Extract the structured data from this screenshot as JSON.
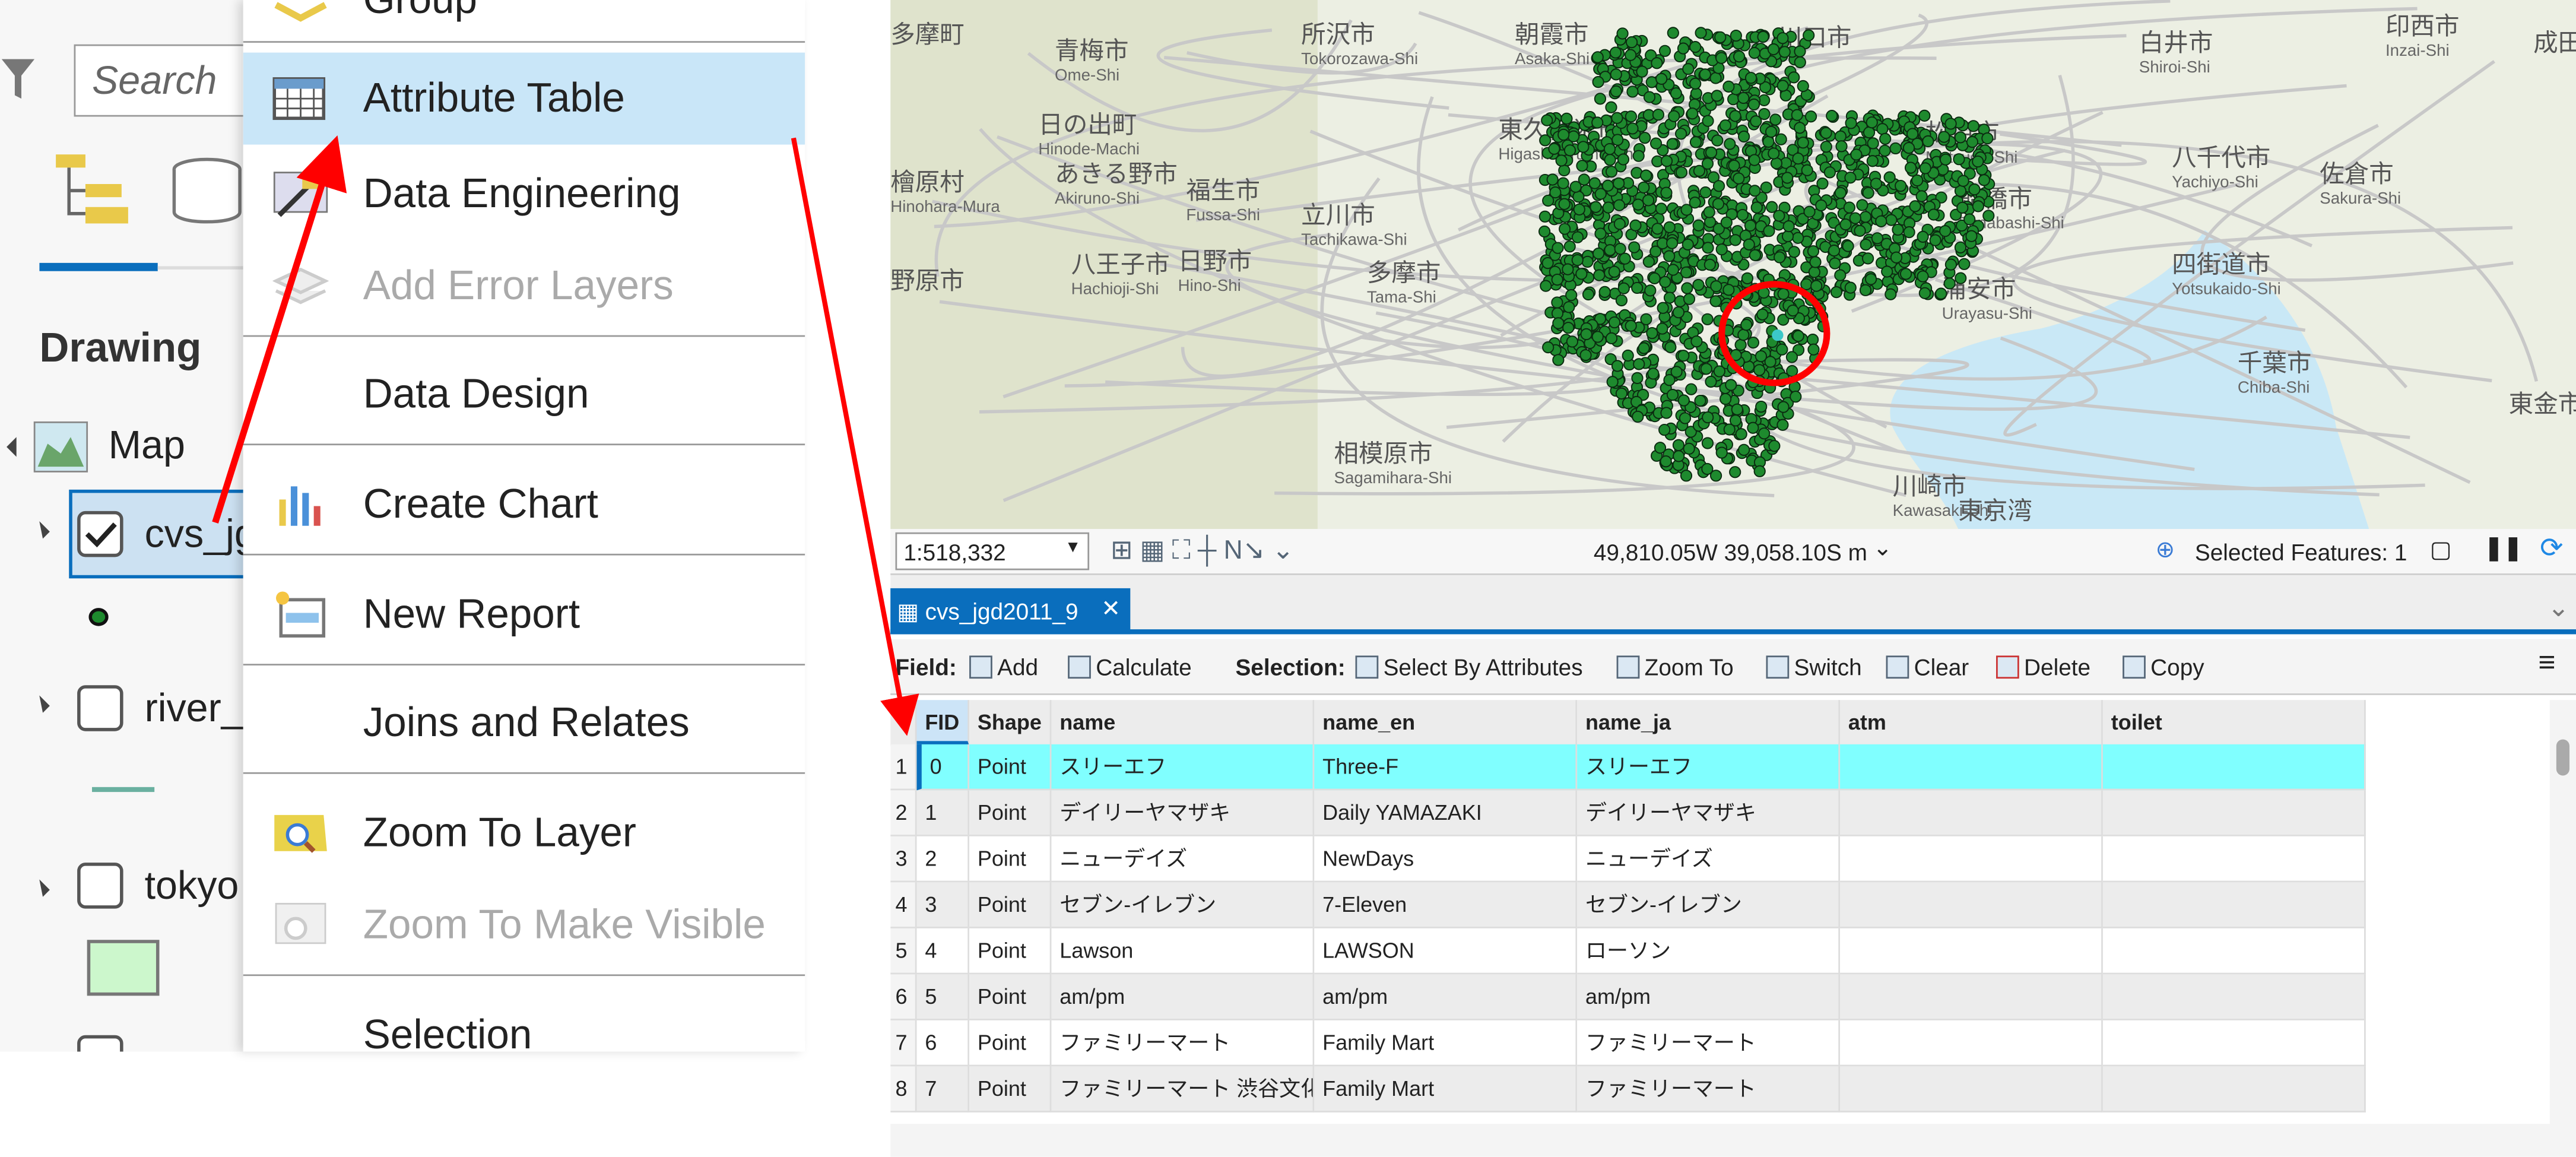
{
  "toc": {
    "search_placeholder": "Search",
    "heading": "Drawing",
    "layers": [
      {
        "label": "Map",
        "checked": null
      },
      {
        "label": "cvs_jg",
        "checked": true
      },
      {
        "label": "river_",
        "checked": false
      },
      {
        "label": "tokyo",
        "checked": false
      }
    ]
  },
  "menu": {
    "items": [
      {
        "label": "Group",
        "icon": "group-icon",
        "disabled": false
      },
      {
        "label": "Attribute Table",
        "icon": "table-icon",
        "disabled": false,
        "highlighted": true
      },
      {
        "label": "Data Engineering",
        "icon": "data-engineering-icon",
        "disabled": false
      },
      {
        "label": "Add Error Layers",
        "icon": "error-layers-icon",
        "disabled": true
      },
      {
        "label": "Data Design",
        "icon": "",
        "disabled": false
      },
      {
        "label": "Create Chart",
        "icon": "chart-icon",
        "disabled": false
      },
      {
        "label": "New Report",
        "icon": "report-icon",
        "disabled": false
      },
      {
        "label": "Joins and Relates",
        "icon": "",
        "disabled": false
      },
      {
        "label": "Zoom To Layer",
        "icon": "zoom-layer-icon",
        "disabled": false
      },
      {
        "label": "Zoom To Make Visible",
        "icon": "zoom-visible-icon",
        "disabled": true
      },
      {
        "label": "Selection",
        "icon": "",
        "disabled": false
      }
    ]
  },
  "map": {
    "labels": [
      {
        "ja": "多摩町",
        "en": ""
      },
      {
        "ja": "青梅市",
        "en": "Ome-Shi"
      },
      {
        "ja": "所沢市",
        "en": "Tokorozawa-Shi"
      },
      {
        "ja": "朝霞市",
        "en": "Asaka-Shi"
      },
      {
        "ja": "川口市",
        "en": ""
      },
      {
        "ja": "白井市",
        "en": "Shiroi-Shi"
      },
      {
        "ja": "印西市",
        "en": "Inzai-Shi"
      },
      {
        "ja": "成田市",
        "en": ""
      },
      {
        "ja": "日の出町",
        "en": "Hinode-Machi"
      },
      {
        "ja": "東久留米市",
        "en": "Higashikurume-Shi"
      },
      {
        "ja": "松戸市",
        "en": "Matsudo-Shi"
      },
      {
        "ja": "檜原村",
        "en": "Hinohara-Mura"
      },
      {
        "ja": "あきる野市",
        "en": "Akiruno-Shi"
      },
      {
        "ja": "福生市",
        "en": "Fussa-Shi"
      },
      {
        "ja": "立川市",
        "en": "Tachikawa-Shi"
      },
      {
        "ja": "八千代市",
        "en": "Yachiyo-Shi"
      },
      {
        "ja": "佐倉市",
        "en": "Sakura-Shi"
      },
      {
        "ja": "船橋市",
        "en": "Funabashi-Shi"
      },
      {
        "ja": "八王子市",
        "en": "Hachioji-Shi"
      },
      {
        "ja": "日野市",
        "en": "Hino-Shi"
      },
      {
        "ja": "多摩市",
        "en": "Tama-Shi"
      },
      {
        "ja": "浦安市",
        "en": "Urayasu-Shi"
      },
      {
        "ja": "四街道市",
        "en": "Yotsukaido-Shi"
      },
      {
        "ja": "野原市",
        "en": ""
      },
      {
        "ja": "千葉市",
        "en": "Chiba-Shi"
      },
      {
        "ja": "相模原市",
        "en": "Sagamihara-Shi"
      },
      {
        "ja": "川崎市",
        "en": "Kawasaki-Shi"
      },
      {
        "ja": "東京湾",
        "en": ""
      },
      {
        "ja": "東金市",
        "en": ""
      }
    ],
    "point_color": "#1e8a2e",
    "selected_color": "#3cc8c8",
    "scale": "1:518,332",
    "coordinates": "49,810.05W 39,058.10S m",
    "selected_features": "Selected Features: 1"
  },
  "table": {
    "tab_label": "cvs_jgd2011_9",
    "toolbar": {
      "field_label": "Field:",
      "add": "Add",
      "calculate": "Calculate",
      "selection_label": "Selection:",
      "select_by_attributes": "Select By Attributes",
      "zoom_to": "Zoom To",
      "switch": "Switch",
      "clear": "Clear",
      "delete": "Delete",
      "copy": "Copy"
    },
    "columns": [
      "FID",
      "Shape",
      "name",
      "name_en",
      "name_ja",
      "atm",
      "toilet"
    ],
    "rows": [
      {
        "n": "1",
        "FID": "0",
        "Shape": "Point",
        "name": "スリーエフ",
        "name_en": "Three-F",
        "name_ja": "スリーエフ",
        "atm": "",
        "toilet": "",
        "selected": true
      },
      {
        "n": "2",
        "FID": "1",
        "Shape": "Point",
        "name": "デイリーヤマザキ",
        "name_en": "Daily YAMAZAKI",
        "name_ja": "デイリーヤマザキ",
        "atm": "",
        "toilet": ""
      },
      {
        "n": "3",
        "FID": "2",
        "Shape": "Point",
        "name": "ニューデイズ",
        "name_en": "NewDays",
        "name_ja": "ニューデイズ",
        "atm": "",
        "toilet": ""
      },
      {
        "n": "4",
        "FID": "3",
        "Shape": "Point",
        "name": "セブン-イレブン",
        "name_en": "7-Eleven",
        "name_ja": "セブン-イレブン",
        "atm": "",
        "toilet": ""
      },
      {
        "n": "5",
        "FID": "4",
        "Shape": "Point",
        "name": "Lawson",
        "name_en": "LAWSON",
        "name_ja": "ローソン",
        "atm": "",
        "toilet": ""
      },
      {
        "n": "6",
        "FID": "5",
        "Shape": "Point",
        "name": "am/pm",
        "name_en": "am/pm",
        "name_ja": "am/pm",
        "atm": "",
        "toilet": ""
      },
      {
        "n": "7",
        "FID": "6",
        "Shape": "Point",
        "name": "ファミリーマート",
        "name_en": "Family Mart",
        "name_ja": "ファミリーマート",
        "atm": "",
        "toilet": ""
      },
      {
        "n": "8",
        "FID": "7",
        "Shape": "Point",
        "name": "ファミリーマート 渋谷文化...",
        "name_en": "Family Mart",
        "name_ja": "ファミリーマート",
        "atm": "",
        "toilet": ""
      }
    ],
    "selected_row_color": "#80ffff"
  },
  "annotation_color": "#ff0000"
}
